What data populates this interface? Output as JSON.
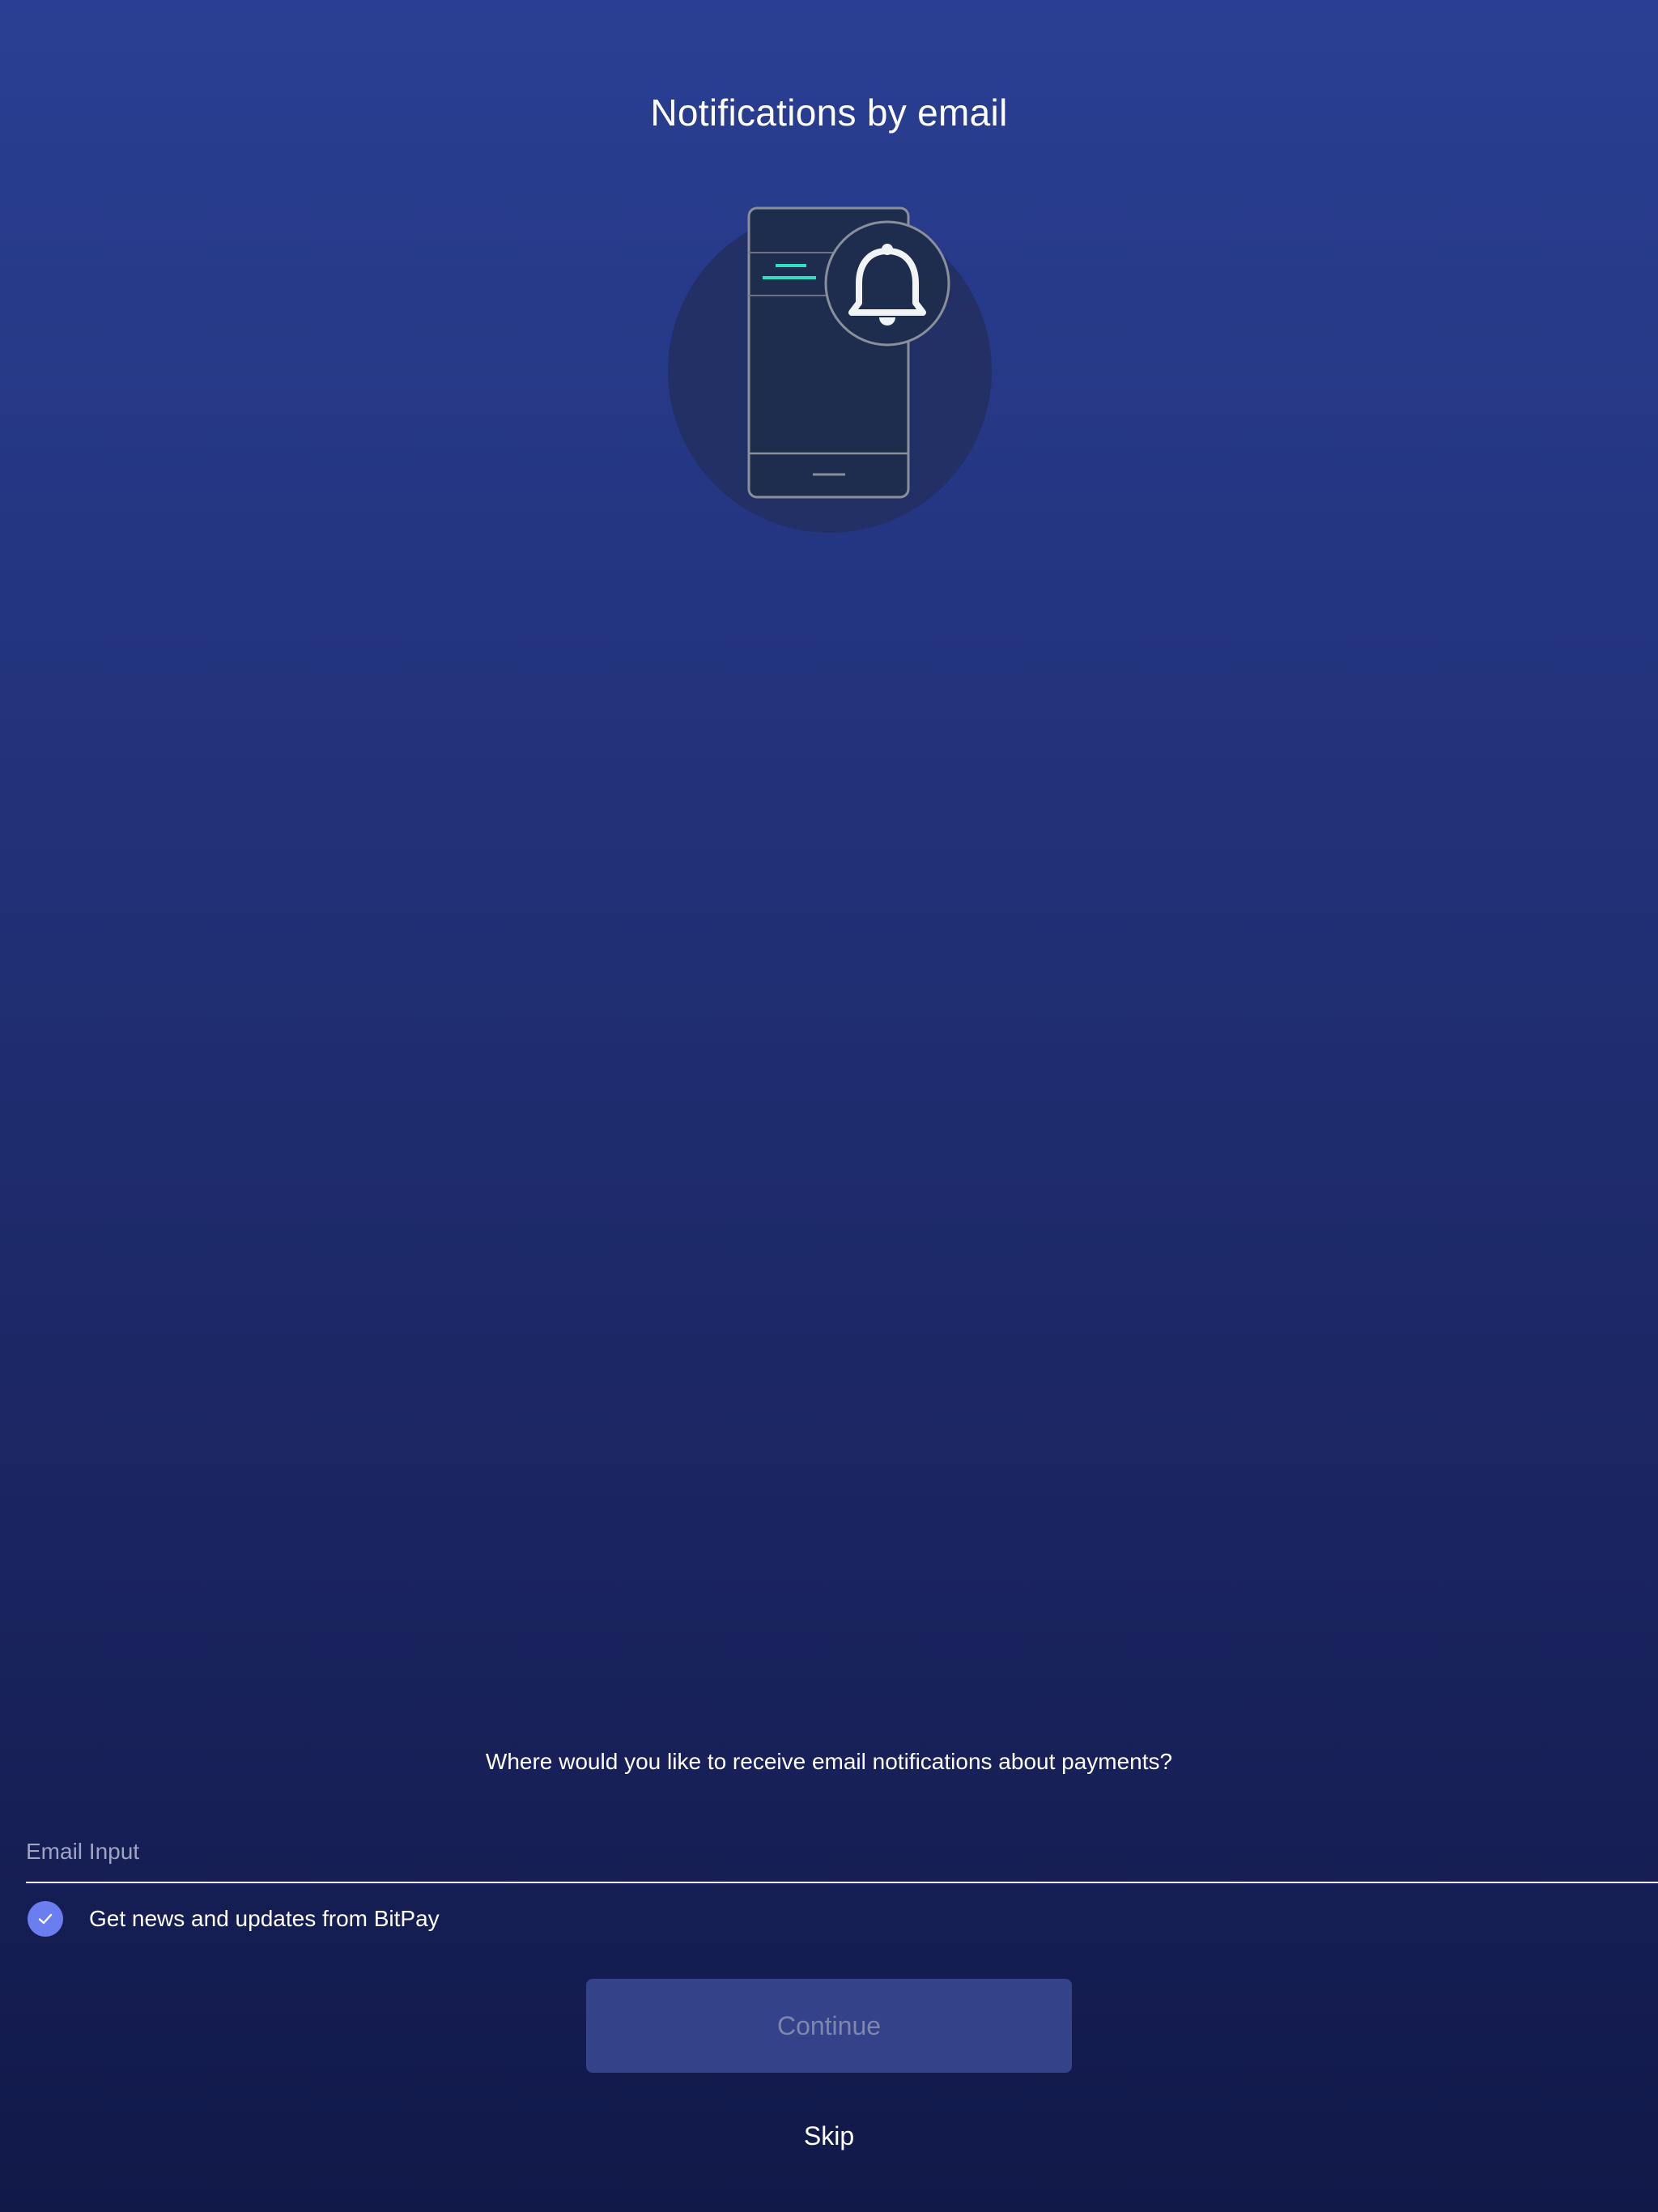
{
  "header": {
    "title": "Notifications by email"
  },
  "illustration": {
    "icon": "bell-icon",
    "accent_color": "#2fe0c0"
  },
  "form": {
    "prompt": "Where would you like to receive email notifications about payments?",
    "email_value": "",
    "email_placeholder": "Email Input",
    "newsletter_label": "Get news and updates from BitPay",
    "newsletter_checked": true,
    "checkbox_color": "#6b7ef0"
  },
  "actions": {
    "continue_label": "Continue",
    "continue_disabled": true,
    "skip_label": "Skip"
  }
}
